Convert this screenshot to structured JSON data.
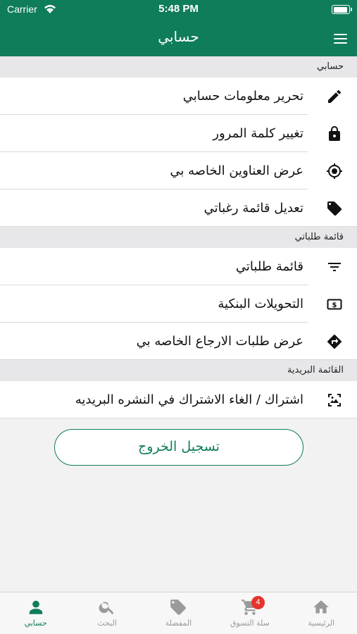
{
  "status_bar": {
    "carrier": "Carrier",
    "time": "5:48 PM"
  },
  "nav": {
    "title": "حسابي"
  },
  "sections": [
    {
      "title": "حسابي",
      "items": [
        {
          "label": "تحرير معلومات حسابي",
          "icon": "pencil-icon"
        },
        {
          "label": "تغيير كلمة المرور",
          "icon": "lock-icon"
        },
        {
          "label": "عرض العناوين الخاصه بي",
          "icon": "location-target-icon"
        },
        {
          "label": "تعديل قائمة رغباتي",
          "icon": "tag-icon"
        }
      ]
    },
    {
      "title": "قائمة طلباتي",
      "items": [
        {
          "label": "قائمة طلباتي",
          "icon": "filter-list-icon"
        },
        {
          "label": "التحويلات البنكية",
          "icon": "dollar-bill-icon"
        },
        {
          "label": "عرض طلبات الارجاع الخاصه بي",
          "icon": "return-direction-icon"
        }
      ]
    },
    {
      "title": "القائمة البريدية",
      "items": [
        {
          "label": "اشتراك / الغاء الاشتراك في النشره البريديه",
          "icon": "newsletter-icon"
        }
      ]
    }
  ],
  "logout_label": "تسجيل الخروج",
  "tabs": [
    {
      "label": "الرئيسية",
      "icon": "home-icon"
    },
    {
      "label": "سلة التسوق",
      "icon": "cart-icon",
      "badge": "4"
    },
    {
      "label": "المفضلة",
      "icon": "tag-icon"
    },
    {
      "label": "البحث",
      "icon": "search-icon"
    },
    {
      "label": "حسابي",
      "icon": "person-icon",
      "active": true
    }
  ],
  "colors": {
    "primary": "#0f7c5b",
    "badge": "#e8332a"
  }
}
